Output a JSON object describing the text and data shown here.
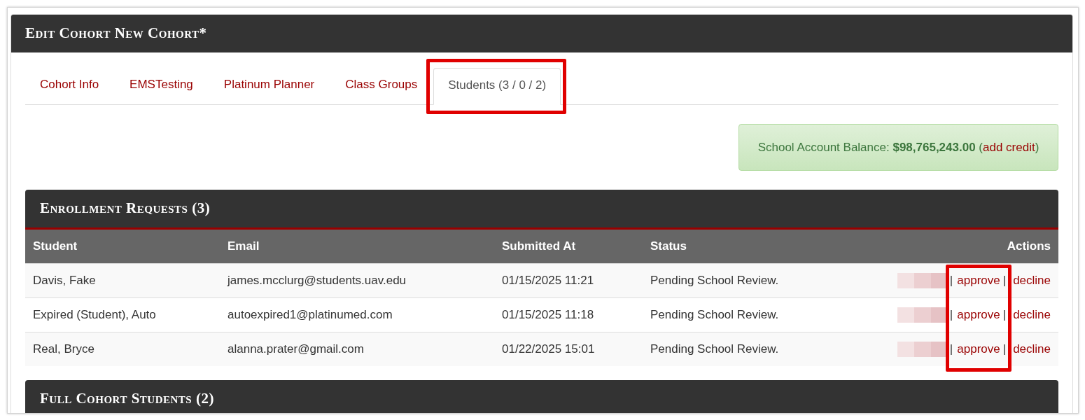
{
  "title": "Edit Cohort New Cohort*",
  "tabs": [
    {
      "label": "Cohort Info",
      "selected": false,
      "highlighted": false
    },
    {
      "label": "EMSTesting",
      "selected": false,
      "highlighted": false
    },
    {
      "label": "Platinum Planner",
      "selected": false,
      "highlighted": false
    },
    {
      "label": "Class Groups",
      "selected": false,
      "highlighted": false
    },
    {
      "label": "Students (3 / 0 / 2)",
      "selected": true,
      "highlighted": true
    }
  ],
  "balance_alert": {
    "text_before": "School Account Balance: **$98,765,243.00** (",
    "link": "add credit",
    "text_after": ")"
  },
  "enrollment_requests": {
    "title": "Enrollment Requests (3)",
    "approve_highlighted": true,
    "columns": [
      "Student",
      "Email",
      "Submitted At",
      "Status",
      "Actions"
    ],
    "rows": [
      {
        "student": "Davis, Fake",
        "email": "james.mcclurg@students.uav.edu",
        "submitted_at": "01/15/2025 11:21",
        "status": "Pending School Review.",
        "redacted": true,
        "actions": [
          {
            "kind": "separator",
            "text": "|"
          },
          {
            "kind": "approve",
            "text": "approve"
          },
          {
            "kind": "separator",
            "text": "|"
          },
          {
            "kind": "decline",
            "text": "decline"
          }
        ]
      },
      {
        "student": "Expired (Student), Auto",
        "email": "autoexpired1@platinumed.com",
        "submitted_at": "01/15/2025 11:18",
        "status": "Pending School Review.",
        "redacted": true,
        "actions": [
          {
            "kind": "separator",
            "text": "|"
          },
          {
            "kind": "approve",
            "text": "approve"
          },
          {
            "kind": "separator",
            "text": "|"
          },
          {
            "kind": "decline",
            "text": "decline"
          }
        ]
      },
      {
        "student": "Real, Bryce",
        "email": "alanna.prater@gmail.com",
        "submitted_at": "01/22/2025 15:01",
        "status": "Pending School Review.",
        "redacted": true,
        "actions": [
          {
            "kind": "separator",
            "text": "|"
          },
          {
            "kind": "approve",
            "text": "approve"
          },
          {
            "kind": "separator",
            "text": "|"
          },
          {
            "kind": "decline",
            "text": "decline"
          }
        ]
      }
    ]
  },
  "full_cohort_students": {
    "title": "Full Cohort Students (2)"
  }
}
